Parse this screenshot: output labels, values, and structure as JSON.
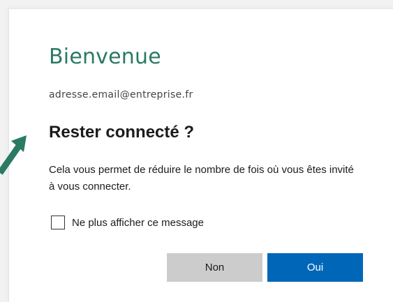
{
  "dialog": {
    "welcome": "Bienvenue",
    "email": "adresse.email@entreprise.fr",
    "heading": "Rester connecté ?",
    "description": "Cela vous permet de réduire le nombre de fois où vous êtes invité à vous connecter.",
    "checkbox_label": "Ne plus afficher ce message",
    "checkbox_checked": false,
    "no_label": "Non",
    "yes_label": "Oui"
  },
  "colors": {
    "accent_green": "#2b7a63",
    "primary_button": "#0067b8",
    "secondary_button": "#cccccc"
  },
  "icons": {
    "annotation": "arrow-up-right-icon"
  }
}
